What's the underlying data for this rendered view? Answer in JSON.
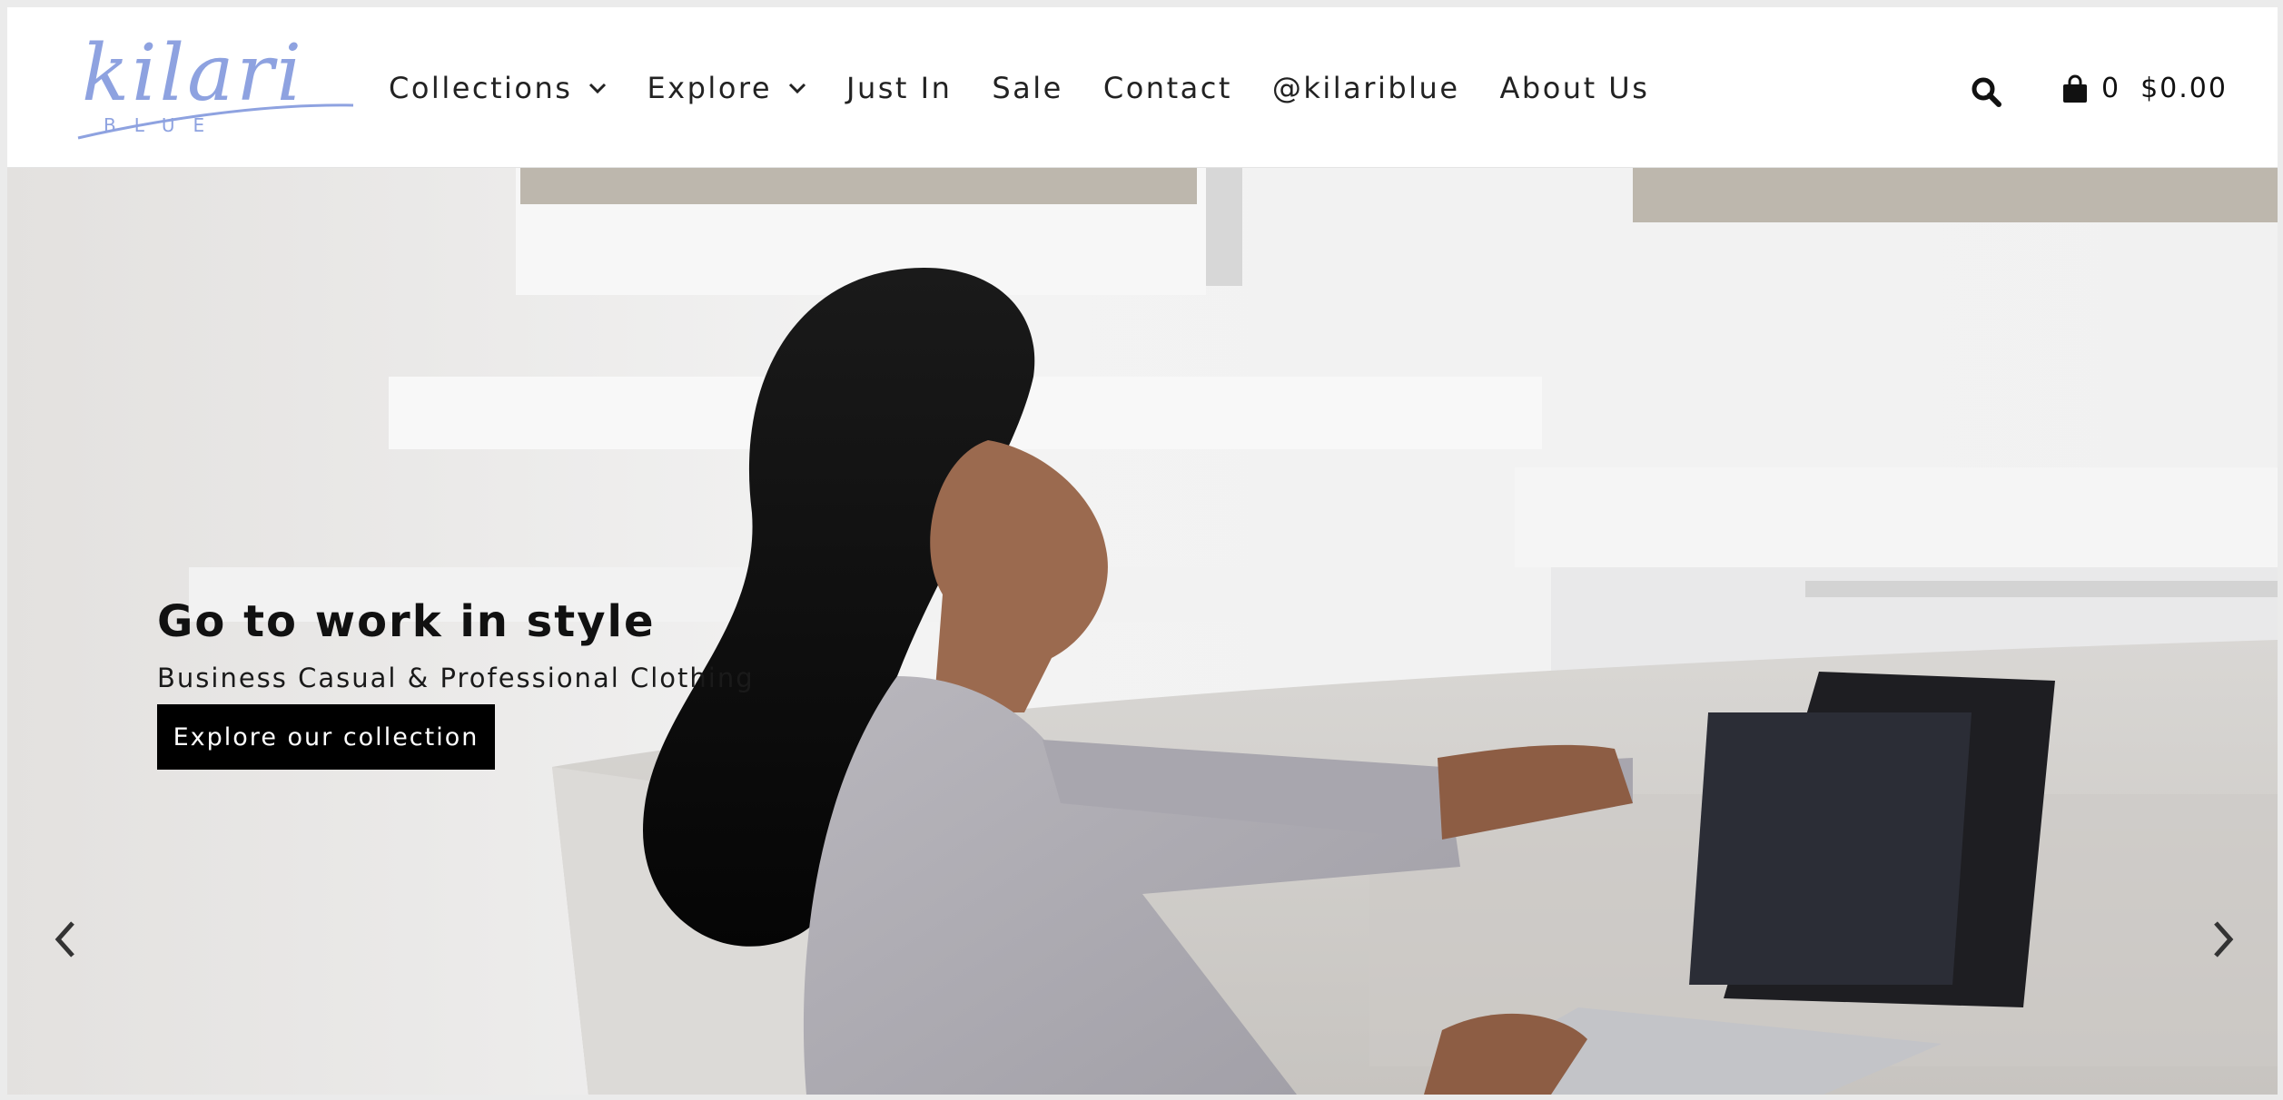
{
  "brand": {
    "logo_script": "kilari",
    "logo_sub": "BLUE",
    "logo_color": "#8ea2e0"
  },
  "nav": {
    "items": [
      {
        "label": "Collections",
        "has_dropdown": true
      },
      {
        "label": "Explore",
        "has_dropdown": true
      },
      {
        "label": "Just In",
        "has_dropdown": false
      },
      {
        "label": "Sale",
        "has_dropdown": false
      },
      {
        "label": "Contact",
        "has_dropdown": false
      },
      {
        "label": "@kilariblue",
        "has_dropdown": false
      },
      {
        "label": "About Us",
        "has_dropdown": false
      }
    ]
  },
  "header_icons": {
    "search": "search-icon",
    "cart": "shopping-bag-icon"
  },
  "cart": {
    "count": "0",
    "total": "$0.00"
  },
  "hero": {
    "title": "Go to work in style",
    "subtitle": "Business Casual & Professional Clothing",
    "cta_label": "Explore our collection",
    "prev_icon": "chevron-left-icon",
    "next_icon": "chevron-right-icon"
  },
  "colors": {
    "cta_bg": "#000000",
    "cta_text": "#ffffff",
    "text": "#222222"
  }
}
